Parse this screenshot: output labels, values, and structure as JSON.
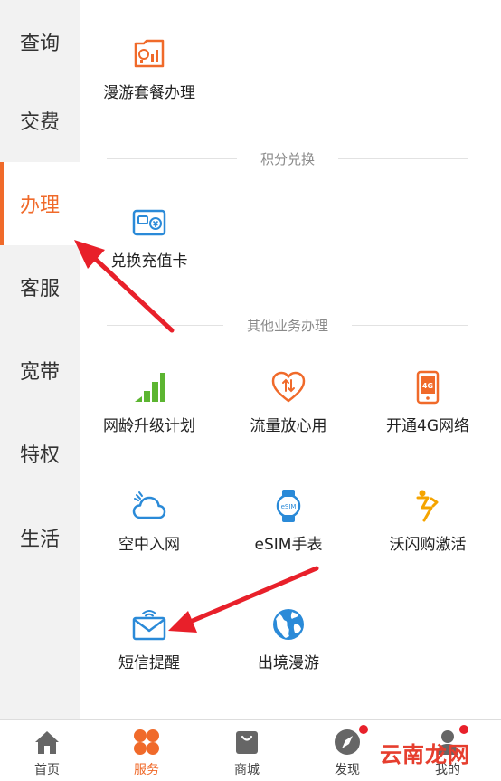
{
  "sidebar": {
    "items": [
      {
        "label": "查询"
      },
      {
        "label": "交费"
      },
      {
        "label": "办理"
      },
      {
        "label": "客服"
      },
      {
        "label": "宽带"
      },
      {
        "label": "特权"
      },
      {
        "label": "生活"
      }
    ],
    "active_index": 2
  },
  "main": {
    "roaming_tile": {
      "label": "漫游套餐办理",
      "icon": "roaming-chart-icon"
    },
    "points_section": {
      "title": "积分兑换",
      "tiles": [
        {
          "label": "兑换充值卡",
          "icon": "recharge-card-icon"
        }
      ]
    },
    "other_section": {
      "title": "其他业务办理",
      "tiles": [
        {
          "label": "网龄升级计划",
          "icon": "signal-bars-icon"
        },
        {
          "label": "流量放心用",
          "icon": "heart-data-icon"
        },
        {
          "label": "开通4G网络",
          "icon": "phone-4g-icon"
        },
        {
          "label": "空中入网",
          "icon": "cloud-icon"
        },
        {
          "label": "eSIM手表",
          "icon": "watch-icon"
        },
        {
          "label": "沃闪购激活",
          "icon": "lightning-person-icon"
        },
        {
          "label": "短信提醒",
          "icon": "sms-envelope-icon"
        },
        {
          "label": "出境漫游",
          "icon": "globe-icon"
        }
      ]
    }
  },
  "tabbar": {
    "tabs": [
      {
        "label": "首页",
        "icon": "home-icon"
      },
      {
        "label": "服务",
        "icon": "grid-icon"
      },
      {
        "label": "商城",
        "icon": "shopping-bag-icon"
      },
      {
        "label": "发现",
        "icon": "compass-icon"
      },
      {
        "label": "我的",
        "icon": "user-icon"
      }
    ],
    "active_index": 1
  },
  "watermark": "云南龙网",
  "colors": {
    "accent": "#f06a2a",
    "blue": "#2a8ad8",
    "green": "#5cb531",
    "badge": "#e8202a",
    "arrow": "#e8202a"
  }
}
